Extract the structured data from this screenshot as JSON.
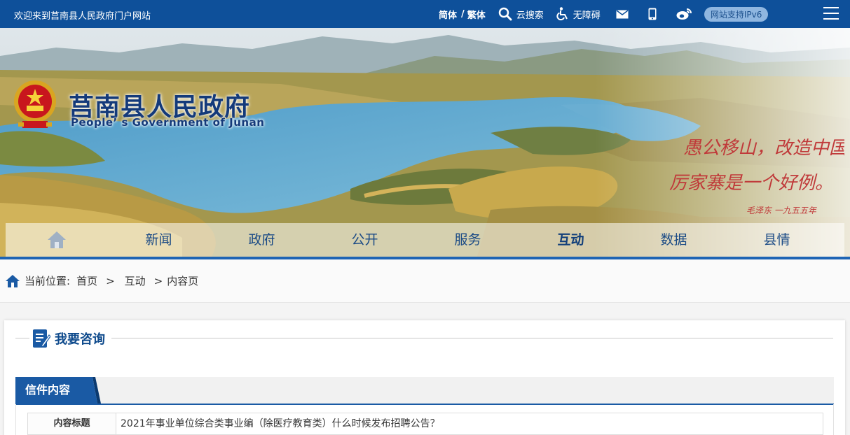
{
  "topbar": {
    "welcome": "欢迎来到莒南县人民政府门户网站",
    "lang_simplified": "简体",
    "lang_sep": "/",
    "lang_traditional": "繁体",
    "search_label": "云搜索",
    "accessibility_label": "无障碍",
    "ipv6_label": "网站支持IPv6"
  },
  "banner": {
    "title": "莒南县人民政府",
    "subtitle": "People’ s Government of Junan",
    "calligraphy": [
      "愚公移山，改造中国",
      "厉家寨是一个好例。",
      "毛泽东 一九五五年"
    ]
  },
  "nav": {
    "items": [
      "新闻",
      "政府",
      "公开",
      "服务",
      "互动",
      "数据",
      "县情"
    ],
    "active": "互动"
  },
  "breadcrumb": {
    "label": "当前位置:",
    "home": "首页",
    "sep": ">",
    "level1": "互动",
    "level2": "内容页"
  },
  "section": {
    "title": "我要咨询",
    "tab": "信件内容"
  },
  "letter": {
    "subject_key": "内容标题",
    "subject_value": "2021年事业单位综合类事业编（除医疗教育类）什么时候发布招聘公告？"
  },
  "colors": {
    "topbar": "#0e509a",
    "accent": "#1a5aa4",
    "title_blue": "#143a7a"
  }
}
